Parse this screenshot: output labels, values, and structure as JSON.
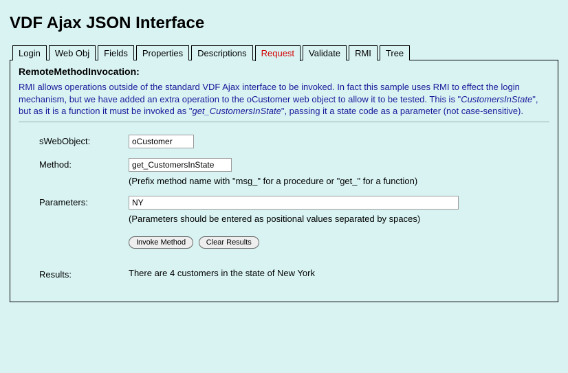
{
  "header": {
    "title": "VDF Ajax JSON Interface"
  },
  "tabs": {
    "login": "Login",
    "webobj": "Web Obj",
    "fields": "Fields",
    "properties": "Properties",
    "descriptions": "Descriptions",
    "request": "Request",
    "validate": "Validate",
    "rmi": "RMI",
    "tree": "Tree",
    "active": "request"
  },
  "panel": {
    "title": "RemoteMethodInvocation:",
    "desc_1": "RMI allows operations outside of the standard VDF Ajax interface to be invoked. In fact this sample uses RMI to effect the login mechanism, but we have added an extra operation to the oCustomer web object to allow it to be tested. This is \"",
    "desc_em1": "CustomersInState",
    "desc_2": "\", but as it is a function it must be invoked as \"",
    "desc_em2": "get_CustomersInState",
    "desc_3": "\", passing it a state code as a parameter (not case-sensitive)."
  },
  "form": {
    "swebobject": {
      "label": "sWebObject:",
      "value": "oCustomer"
    },
    "method": {
      "label": "Method:",
      "value": "get_CustomersInState",
      "hint": "(Prefix method name with \"msg_\" for a procedure or \"get_\" for a function)"
    },
    "parameters": {
      "label": "Parameters:",
      "value": "NY",
      "hint": "(Parameters should be entered as positional values separated by spaces)"
    },
    "results": {
      "label": "Results:",
      "value": "There are 4 customers in the state of New York"
    }
  },
  "buttons": {
    "invoke": "Invoke Method",
    "clear": "Clear Results"
  }
}
